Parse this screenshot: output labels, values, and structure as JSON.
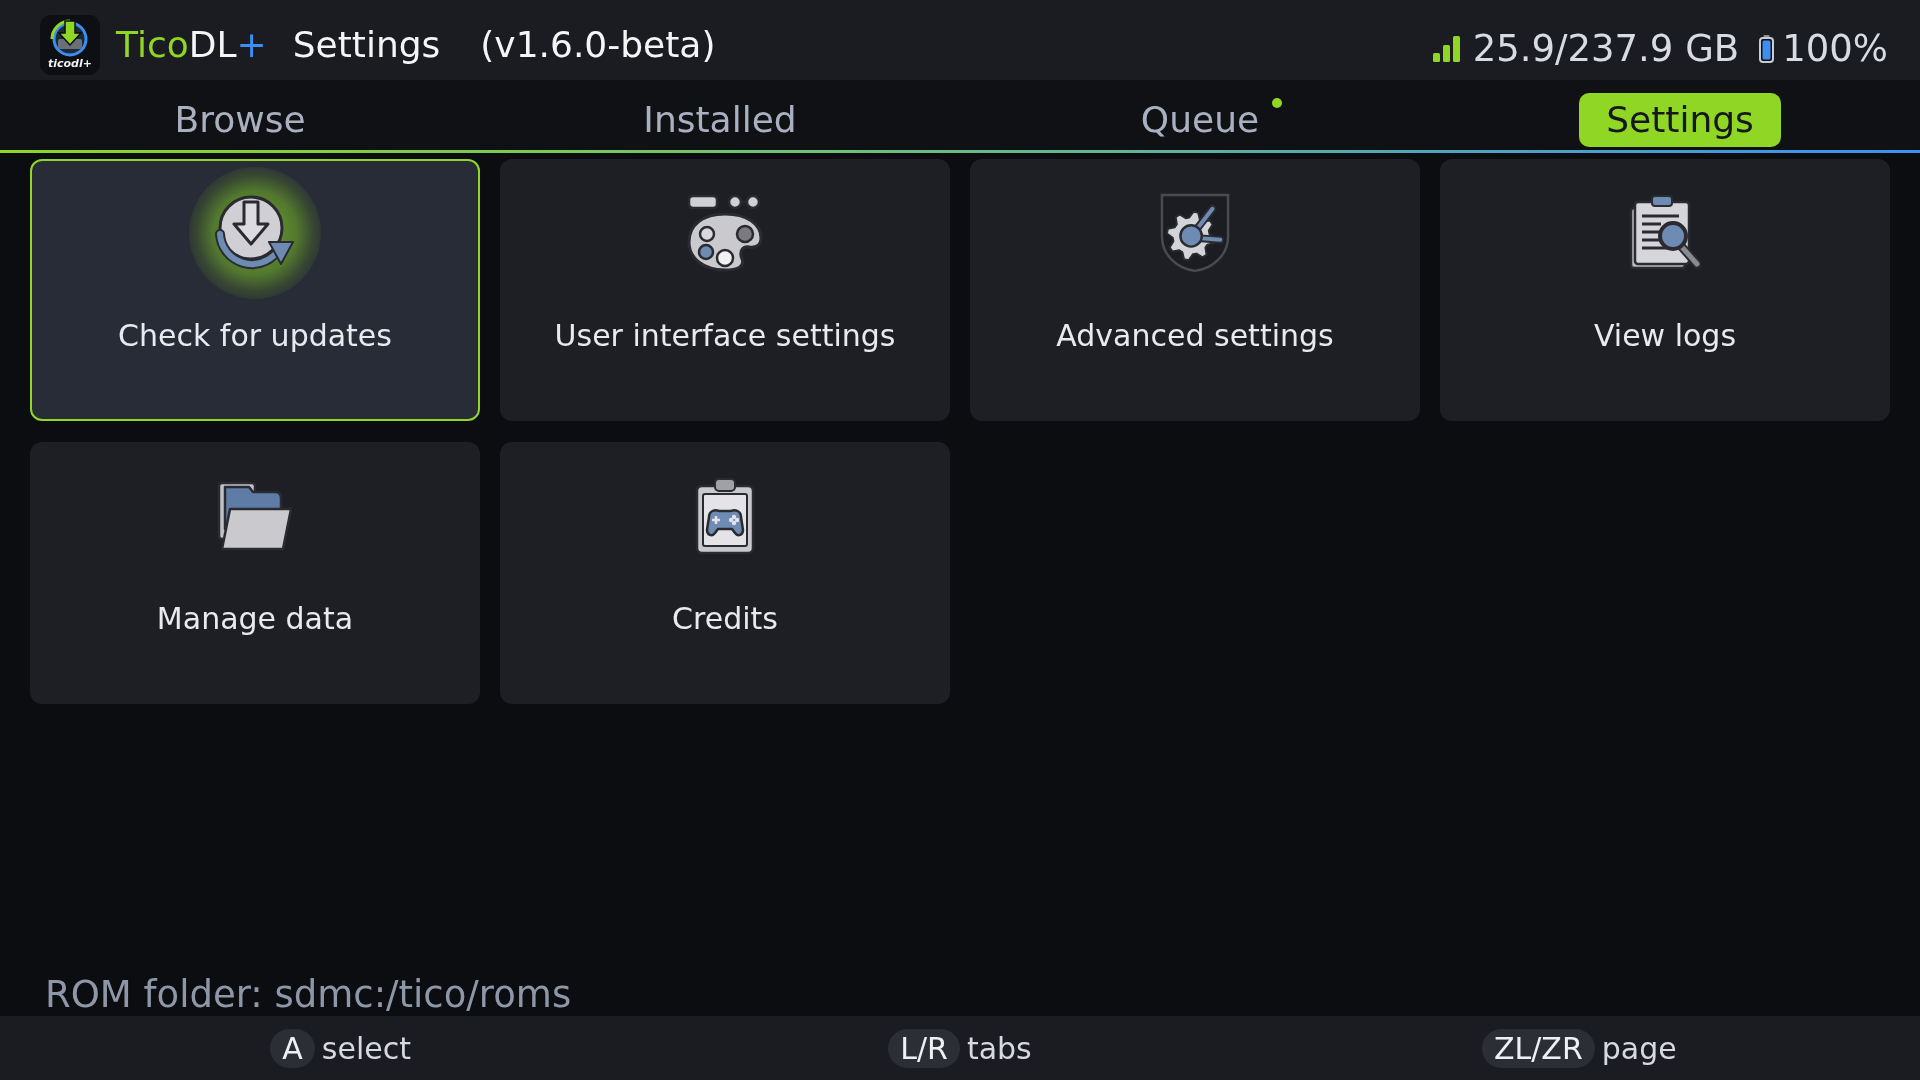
{
  "header": {
    "logo_text": "ticodl+",
    "brand": [
      {
        "text": "Tico",
        "color": "#8fd625"
      },
      {
        "text": "DL",
        "color": "#f4f5f7"
      },
      {
        "text": "+",
        "color": "#3d8ef0"
      }
    ],
    "title": "Settings",
    "version": "(v1.6.0-beta)",
    "storage": "25.9/237.9 GB",
    "battery": "100%"
  },
  "tabs": [
    {
      "label": "Browse",
      "selected": false,
      "notification": false
    },
    {
      "label": "Installed",
      "selected": false,
      "notification": false
    },
    {
      "label": "Queue",
      "selected": false,
      "notification": true
    },
    {
      "label": "Settings",
      "selected": true,
      "notification": false
    }
  ],
  "cards": [
    {
      "label": "Check for updates",
      "kind": "update",
      "selected": true
    },
    {
      "label": "User interface settings",
      "kind": "palette",
      "selected": false
    },
    {
      "label": "Advanced settings",
      "kind": "advanced",
      "selected": false
    },
    {
      "label": "View logs",
      "kind": "logs",
      "selected": false
    },
    {
      "label": "Manage data",
      "kind": "folder",
      "selected": false
    },
    {
      "label": "Credits",
      "kind": "credits",
      "selected": false
    }
  ],
  "rom_folder": "ROM folder: sdmc:/tico/roms",
  "hints": [
    {
      "key": "A",
      "action": "select"
    },
    {
      "key": "L/R",
      "action": "tabs"
    },
    {
      "key": "ZL/ZR",
      "action": "page"
    }
  ]
}
